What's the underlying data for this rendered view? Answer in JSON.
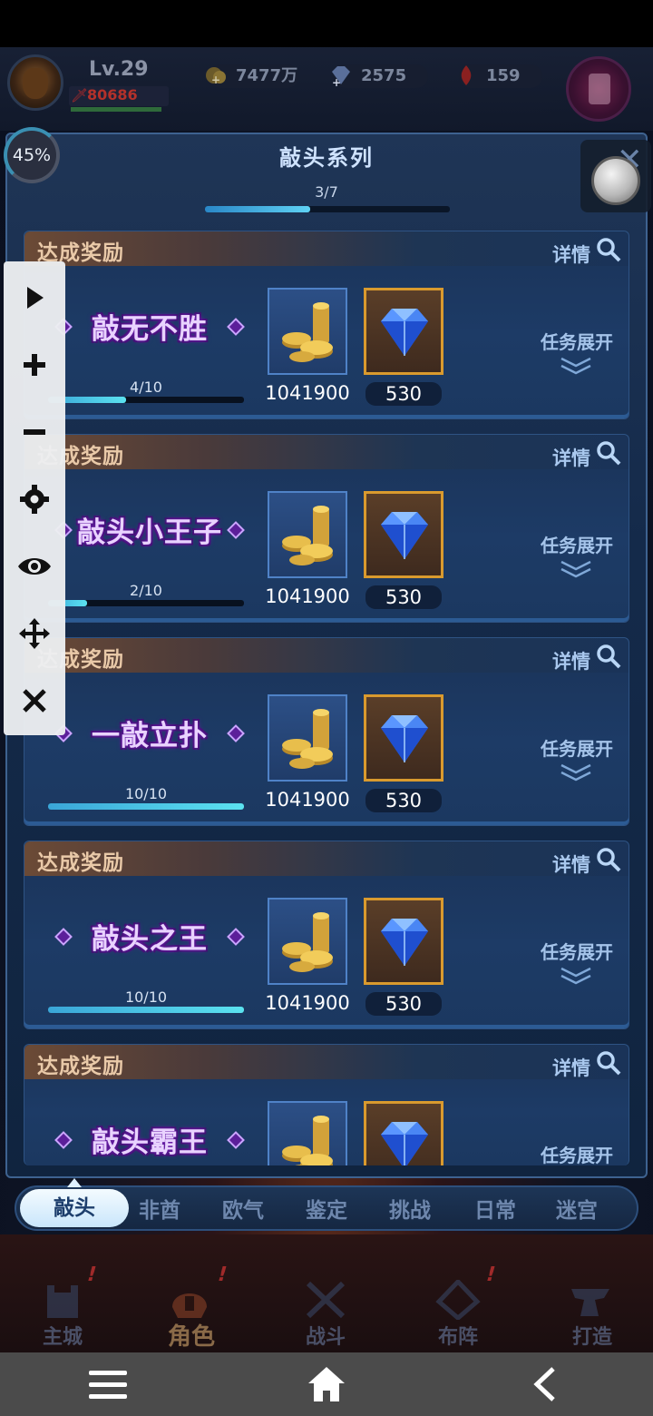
{
  "header": {
    "level": "Lv.29",
    "power": "80686",
    "gold": "7477万",
    "diamonds": "2575",
    "rubies": "159",
    "percent": "45%"
  },
  "panel": {
    "title": "敲头系列",
    "progress_text": "3/7",
    "progress": 0.428
  },
  "cards": [
    {
      "head": "达成奖励",
      "detail": "详情",
      "title": "敲无不胜",
      "progress_text": "4/10",
      "progress": 0.4,
      "gold_qty": "1041900",
      "gem_qty": "530",
      "expand": "任务展开"
    },
    {
      "head": "达成奖励",
      "detail": "详情",
      "title": "敲头小王子",
      "progress_text": "2/10",
      "progress": 0.2,
      "gold_qty": "1041900",
      "gem_qty": "530",
      "expand": "任务展开"
    },
    {
      "head": "达成奖励",
      "detail": "详情",
      "title": "一敲立扑",
      "progress_text": "10/10",
      "progress": 1.0,
      "gold_qty": "1041900",
      "gem_qty": "530",
      "expand": "任务展开"
    },
    {
      "head": "达成奖励",
      "detail": "详情",
      "title": "敲头之王",
      "progress_text": "10/10",
      "progress": 1.0,
      "gold_qty": "1041900",
      "gem_qty": "530",
      "expand": "任务展开"
    },
    {
      "head": "达成奖励",
      "detail": "详情",
      "title": "敲头霸王",
      "expand": "任务展开"
    }
  ],
  "tabs": [
    "敲头",
    "非酋",
    "欧气",
    "鉴定",
    "挑战",
    "日常",
    "迷宫"
  ],
  "game_nav": [
    "主城",
    "角色",
    "战斗",
    "布阵",
    "打造"
  ],
  "game_nav_badges": [
    "!",
    "!",
    "!"
  ],
  "floating_toolbar": [
    "play-icon",
    "plus-icon",
    "minus-icon",
    "gear-icon",
    "eye-icon",
    "move-icon",
    "close-icon"
  ],
  "system_nav": [
    "menu-icon",
    "home-icon",
    "back-icon"
  ],
  "colors": {
    "accent": "#5fd2f4",
    "title_glow": "#6a1fa8",
    "gem_frame": "#d99a2e"
  }
}
